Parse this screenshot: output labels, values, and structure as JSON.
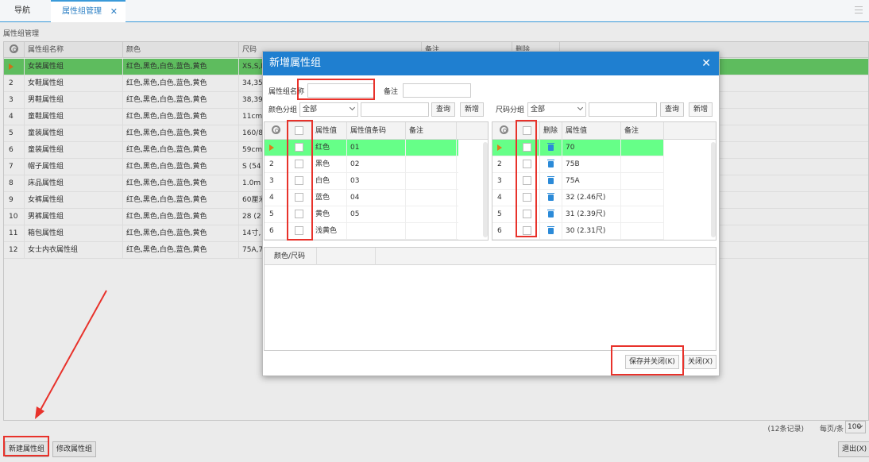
{
  "tabs": {
    "nav": "导航",
    "attr": "属性组管理",
    "close": "✕"
  },
  "breadcrumb": "属性组管理",
  "grid": {
    "headers": [
      "属性组名称",
      "颜色",
      "尺码",
      "备注",
      "删除"
    ],
    "rows": [
      {
        "no": "",
        "name": "女装属性组",
        "color": "红色,黑色,白色,蓝色,黄色",
        "size": "XS,S,M"
      },
      {
        "no": "2",
        "name": "女鞋属性组",
        "color": "红色,黑色,白色,蓝色,黄色",
        "size": "34,35,"
      },
      {
        "no": "3",
        "name": "男鞋属性组",
        "color": "红色,黑色,白色,蓝色,黄色",
        "size": "38,39,"
      },
      {
        "no": "4",
        "name": "童鞋属性组",
        "color": "红色,黑色,白色,蓝色,黄色",
        "size": "11cm,"
      },
      {
        "no": "5",
        "name": "童装属性组",
        "color": "红色,黑色,白色,蓝色,黄色",
        "size": "160/8"
      },
      {
        "no": "6",
        "name": "童装属性组",
        "color": "红色,黑色,白色,蓝色,黄色",
        "size": "59cm,"
      },
      {
        "no": "7",
        "name": "帽子属性组",
        "color": "红色,黑色,白色,蓝色,黄色",
        "size": "S (54"
      },
      {
        "no": "8",
        "name": "床品属性组",
        "color": "红色,黑色,白色,蓝色,黄色",
        "size": "1.0m"
      },
      {
        "no": "9",
        "name": "女裤属性组",
        "color": "红色,黑色,白色,蓝色,黄色",
        "size": "60厘米"
      },
      {
        "no": "10",
        "name": "男裤属性组",
        "color": "红色,黑色,白色,蓝色,黄色",
        "size": "28 (2"
      },
      {
        "no": "11",
        "name": "箱包属性组",
        "color": "红色,黑色,白色,蓝色,黄色",
        "size": "14寸,"
      },
      {
        "no": "12",
        "name": "女士内衣属性组",
        "color": "红色,黑色,白色,蓝色,黄色",
        "size": "75A,7"
      }
    ]
  },
  "footer": {
    "records": "(12条记录)",
    "per_page_label": "每页/条",
    "per_page": "100"
  },
  "buttons": {
    "new_group": "新建属性组",
    "edit_group": "修改属性组",
    "exit": "退出(X)"
  },
  "dialog": {
    "title": "新增属性组",
    "name_label": "属性组名称",
    "name_value": "",
    "remark_label": "备注",
    "remark_value": "",
    "color_group_label": "颜色分组",
    "color_group_value": "全部",
    "size_group_label": "尺码分组",
    "size_group_value": "全部",
    "query": "查询",
    "add": "新增",
    "color_headers": [
      "属性值",
      "属性值条码",
      "备注"
    ],
    "color_rows": [
      {
        "no": "",
        "name": "红色",
        "code": "01"
      },
      {
        "no": "2",
        "name": "黑色",
        "code": "02"
      },
      {
        "no": "3",
        "name": "白色",
        "code": "03"
      },
      {
        "no": "4",
        "name": "蓝色",
        "code": "04"
      },
      {
        "no": "5",
        "name": "黄色",
        "code": "05"
      },
      {
        "no": "6",
        "name": "浅黄色",
        "code": ""
      }
    ],
    "size_headers": [
      "删除",
      "属性值",
      "备注"
    ],
    "size_rows": [
      {
        "no": "",
        "value": "70"
      },
      {
        "no": "2",
        "value": "75B"
      },
      {
        "no": "3",
        "value": "75A"
      },
      {
        "no": "4",
        "value": "32 (2.46尺)"
      },
      {
        "no": "5",
        "value": "31 (2.39尺)"
      },
      {
        "no": "6",
        "value": "30 (2.31尺)"
      }
    ],
    "matrix_header": "颜色/尺码",
    "save_close": "保存并关闭(K)",
    "close": "关闭(X)"
  },
  "colors": {
    "accent": "#1f7fd0",
    "selected_row": "#66cc66",
    "annotation": "#e8322b"
  }
}
